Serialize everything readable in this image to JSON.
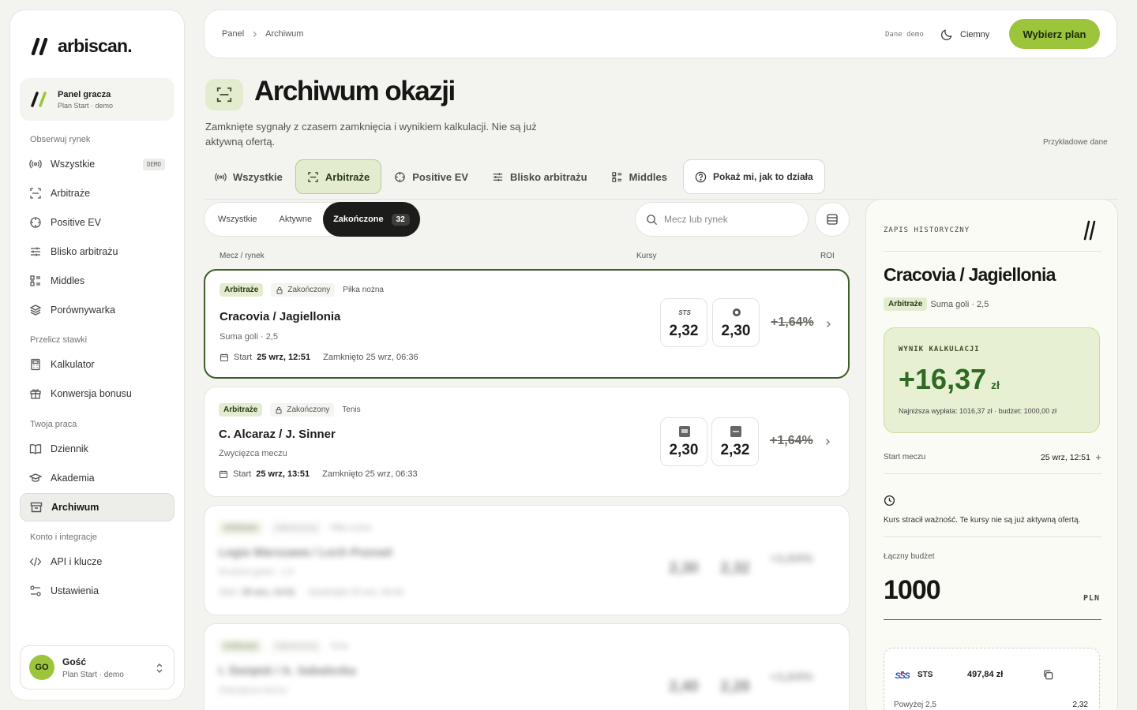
{
  "brand": {
    "name": "arbiscan."
  },
  "sidebar": {
    "panel_title": "Panel gracza",
    "panel_sub": "Plan Start · demo",
    "sections": [
      "Obserwuj rynek",
      "Przelicz stawki",
      "Twoja praca",
      "Konto i integracje"
    ],
    "items": [
      {
        "label": "Wszystkie",
        "icon": "broadcast-icon",
        "badge": "DEMO"
      },
      {
        "label": "Arbitraże",
        "icon": "scan-icon"
      },
      {
        "label": "Positive EV",
        "icon": "crosshair-icon"
      },
      {
        "label": "Blisko arbitrażu",
        "icon": "sliders-icon"
      },
      {
        "label": "Middles",
        "icon": "list-icon"
      },
      {
        "label": "Porównywarka",
        "icon": "layers-icon"
      },
      {
        "label": "Kalkulator",
        "icon": "calculator-icon"
      },
      {
        "label": "Konwersja bonusu",
        "icon": "gift-icon"
      },
      {
        "label": "Dziennik",
        "icon": "book-icon"
      },
      {
        "label": "Akademia",
        "icon": "graduation-icon"
      },
      {
        "label": "Archiwum",
        "icon": "archive-icon",
        "active": true
      },
      {
        "label": "API i klucze",
        "icon": "code-icon"
      },
      {
        "label": "Ustawienia",
        "icon": "settings-icon"
      }
    ],
    "user": {
      "initials": "GO",
      "name": "Gość",
      "plan": "Plan Start · demo"
    }
  },
  "topbar": {
    "breadcrumb": [
      "Panel",
      "Archiwum"
    ],
    "demo_label": "Dane demo",
    "theme_label": "Ciemny",
    "plan_button": "Wybierz plan"
  },
  "header": {
    "title": "Archiwum okazji",
    "description": "Zamknięte sygnały z czasem zamknięcia i wynikiem kalkulacji. Nie są już aktywną ofertą.",
    "sample_label": "Przykładowe dane"
  },
  "tabs": [
    {
      "label": "Wszystkie",
      "icon": "broadcast-icon"
    },
    {
      "label": "Arbitraże",
      "icon": "scan-icon",
      "active": true
    },
    {
      "label": "Positive EV",
      "icon": "crosshair-icon"
    },
    {
      "label": "Blisko arbitrażu",
      "icon": "sliders-icon"
    },
    {
      "label": "Middles",
      "icon": "list-icon"
    }
  ],
  "help_button": "Pokaż mi, jak to działa",
  "filters": {
    "segments": [
      "Wszystkie",
      "Aktywne",
      "Zakończone"
    ],
    "active_count": "32",
    "search_placeholder": "Mecz lub rynek"
  },
  "columns": {
    "match": "Mecz / rynek",
    "odds": "Kursy",
    "roi": "ROI"
  },
  "rows": [
    {
      "type": "Arbitraże",
      "status": "Zakończony",
      "sport": "Piłka nożna",
      "title": "Cracovia / Jagiellonia",
      "market": "Suma goli · 2,5",
      "start_label": "Start",
      "start": "25 wrz, 12:51",
      "closed": "Zamknięto 25 wrz, 06:36",
      "odds": [
        "2,32",
        "2,30"
      ],
      "roi": "+1,64%"
    },
    {
      "type": "Arbitraże",
      "status": "Zakończony",
      "sport": "Tenis",
      "title": "C. Alcaraz / J. Sinner",
      "market": "Zwycięzca meczu",
      "start_label": "Start",
      "start": "25 wrz, 13:51",
      "closed": "Zamknięto 25 wrz, 06:33",
      "odds": [
        "2,30",
        "2,32"
      ],
      "roi": "+1,64%"
    },
    {
      "type": "Arbitraże",
      "status": "Zakończony",
      "sport": "Piłka nożna",
      "title": "Legia Warszawa / Lech Poznań",
      "market": "Drużyna gości · 1,5",
      "start_label": "Start",
      "start": "25 wrz, 14:51",
      "closed": "Zamknięto 25 wrz, 06:30",
      "odds": [
        "2,30",
        "2,32"
      ],
      "roi": "+1,64%"
    },
    {
      "type": "Arbitraże",
      "status": "Zakończony",
      "sport": "Tenis",
      "title": "I. Świątek / A. Sabalenka",
      "market": "Zwycięzca meczu",
      "start_label": "Start",
      "start": "25 wrz, 15:51",
      "closed": "Zamknięto 25 wrz, 06:27",
      "odds": [
        "2,40",
        "2,28"
      ],
      "roi": "+1,64%"
    }
  ],
  "detail": {
    "label": "ZAPIS HISTORYCZNY",
    "title": "Cracovia / Jagiellonia",
    "tag": "Arbitraże",
    "market": "Suma goli · 2,5",
    "result_label": "WYNIK KALKULACJI",
    "result_value": "+16,37",
    "result_unit": "zł",
    "result_note": "Najniższa wypłata: 1016,37 zł · budżet: 1000,00 zł",
    "start_label": "Start meczu",
    "start_value": "25 wrz, 12:51",
    "warning": "Kurs stracił ważność. Te kursy nie są już aktywną ofertą.",
    "budget_label": "Łączny budżet",
    "budget_value": "1000",
    "budget_currency": "PLN",
    "stake": {
      "bookmaker": "STS",
      "amount": "497,84 zł",
      "market": "Powyżej 2,5",
      "odds": "2,32"
    }
  },
  "colors": {
    "accent": "#9cc53c",
    "accent_soft": "#e4ecd0",
    "selected_border": "#3b5e2a",
    "result_green": "#2f6a22"
  }
}
